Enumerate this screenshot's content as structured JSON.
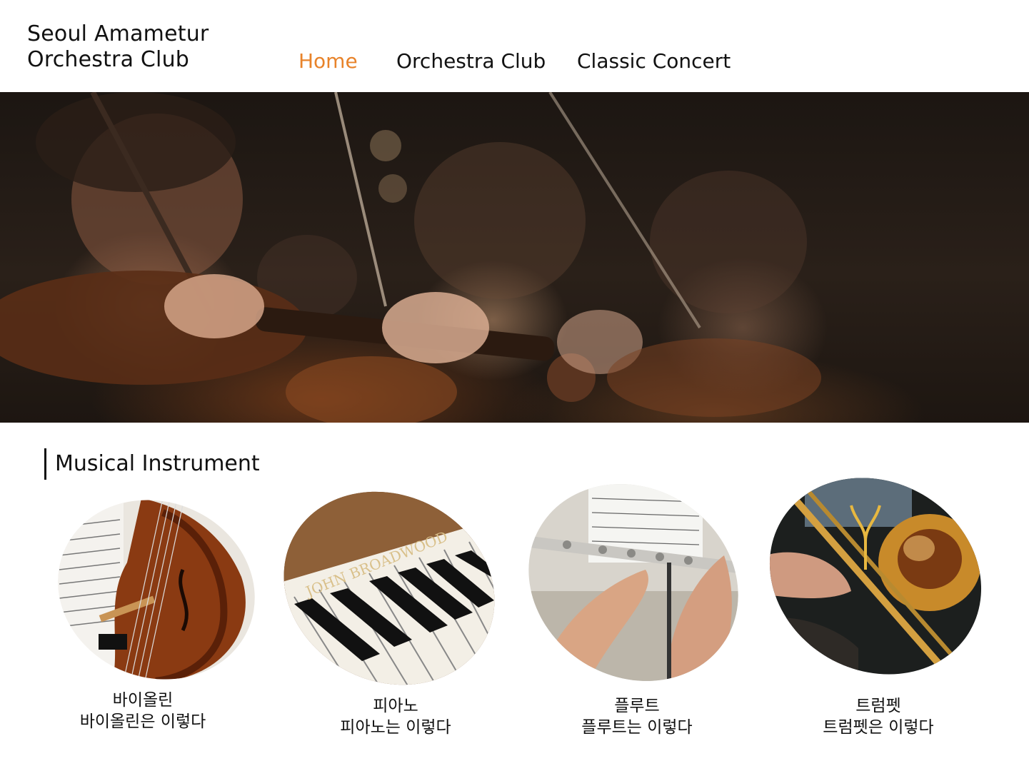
{
  "site": {
    "title_line1": "Seoul Amametur",
    "title_line2": "Orchestra Club"
  },
  "nav": {
    "items": [
      {
        "label": "Home",
        "active": true
      },
      {
        "label": "Orchestra Club",
        "active": false
      },
      {
        "label": "Classic Concert",
        "active": false
      }
    ],
    "active_color": "#e8832a"
  },
  "section": {
    "title": "Musical Instrument"
  },
  "instruments": [
    {
      "name": "바이올린",
      "description": "바이올린은 이렇다",
      "icon": "violin-image"
    },
    {
      "name": "피아노",
      "description": "피아노는 이렇다",
      "icon": "piano-image"
    },
    {
      "name": "플루트",
      "description": "플루트는 이렇다",
      "icon": "flute-image"
    },
    {
      "name": "트럼펫",
      "description": "트럼펫은 이렇다",
      "icon": "trumpet-image"
    }
  ]
}
